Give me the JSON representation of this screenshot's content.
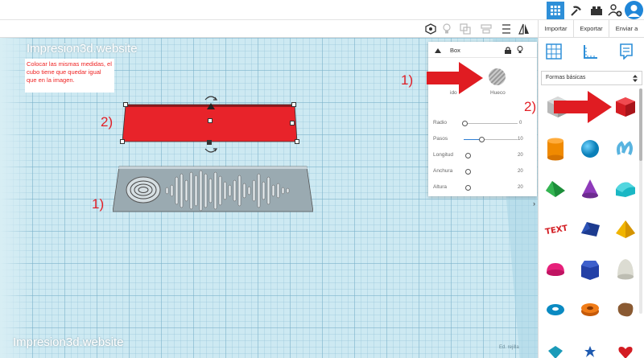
{
  "top_bar": {
    "icons": [
      "grid-view-icon",
      "pickaxe-icon",
      "lego-brick-icon",
      "add-user-icon",
      "user-avatar-icon"
    ]
  },
  "actions": {
    "import": "Importar",
    "export": "Exportar",
    "send": "Enviar a"
  },
  "workplane": {
    "watermark_top": "Impresion3d.website",
    "watermark_bottom": "Impresion3d.website",
    "note": "Colocar las mismas medidas, el cubo tiene que quedar igual que en la imagen.",
    "grid_label": "Ed. rejilla",
    "label_red": "2)",
    "label_plate": "1)"
  },
  "inspector": {
    "title": "Box",
    "solid_label": "ido",
    "hole_label": "Hueco",
    "callout_1": "1)",
    "params": [
      {
        "label": "Radio",
        "value": "0",
        "level": 0
      },
      {
        "label": "Pasos",
        "value": "10",
        "level": 0.4
      },
      {
        "label": "Longitud",
        "value": "20",
        "level": 0
      },
      {
        "label": "Anchura",
        "value": "20",
        "level": 0
      },
      {
        "label": "Altura",
        "value": "20",
        "level": 0
      }
    ]
  },
  "shapes_panel": {
    "category": "Formas básicas",
    "callout_2": "2)",
    "shapes": [
      "hole-box",
      "box",
      "cylinder",
      "sphere",
      "scribble",
      "roof",
      "cone",
      "round-roof",
      "text",
      "wedge",
      "pyramid",
      "half-sphere",
      "polygon",
      "paraboloid",
      "torus",
      "tube",
      "shape-generator",
      "star",
      "heart",
      "gem"
    ]
  },
  "colors": {
    "accent": "#2e8fd8",
    "box_red": "#e8232a",
    "arrow_red": "#e01c22",
    "grid_bg": "#cde9f2"
  }
}
